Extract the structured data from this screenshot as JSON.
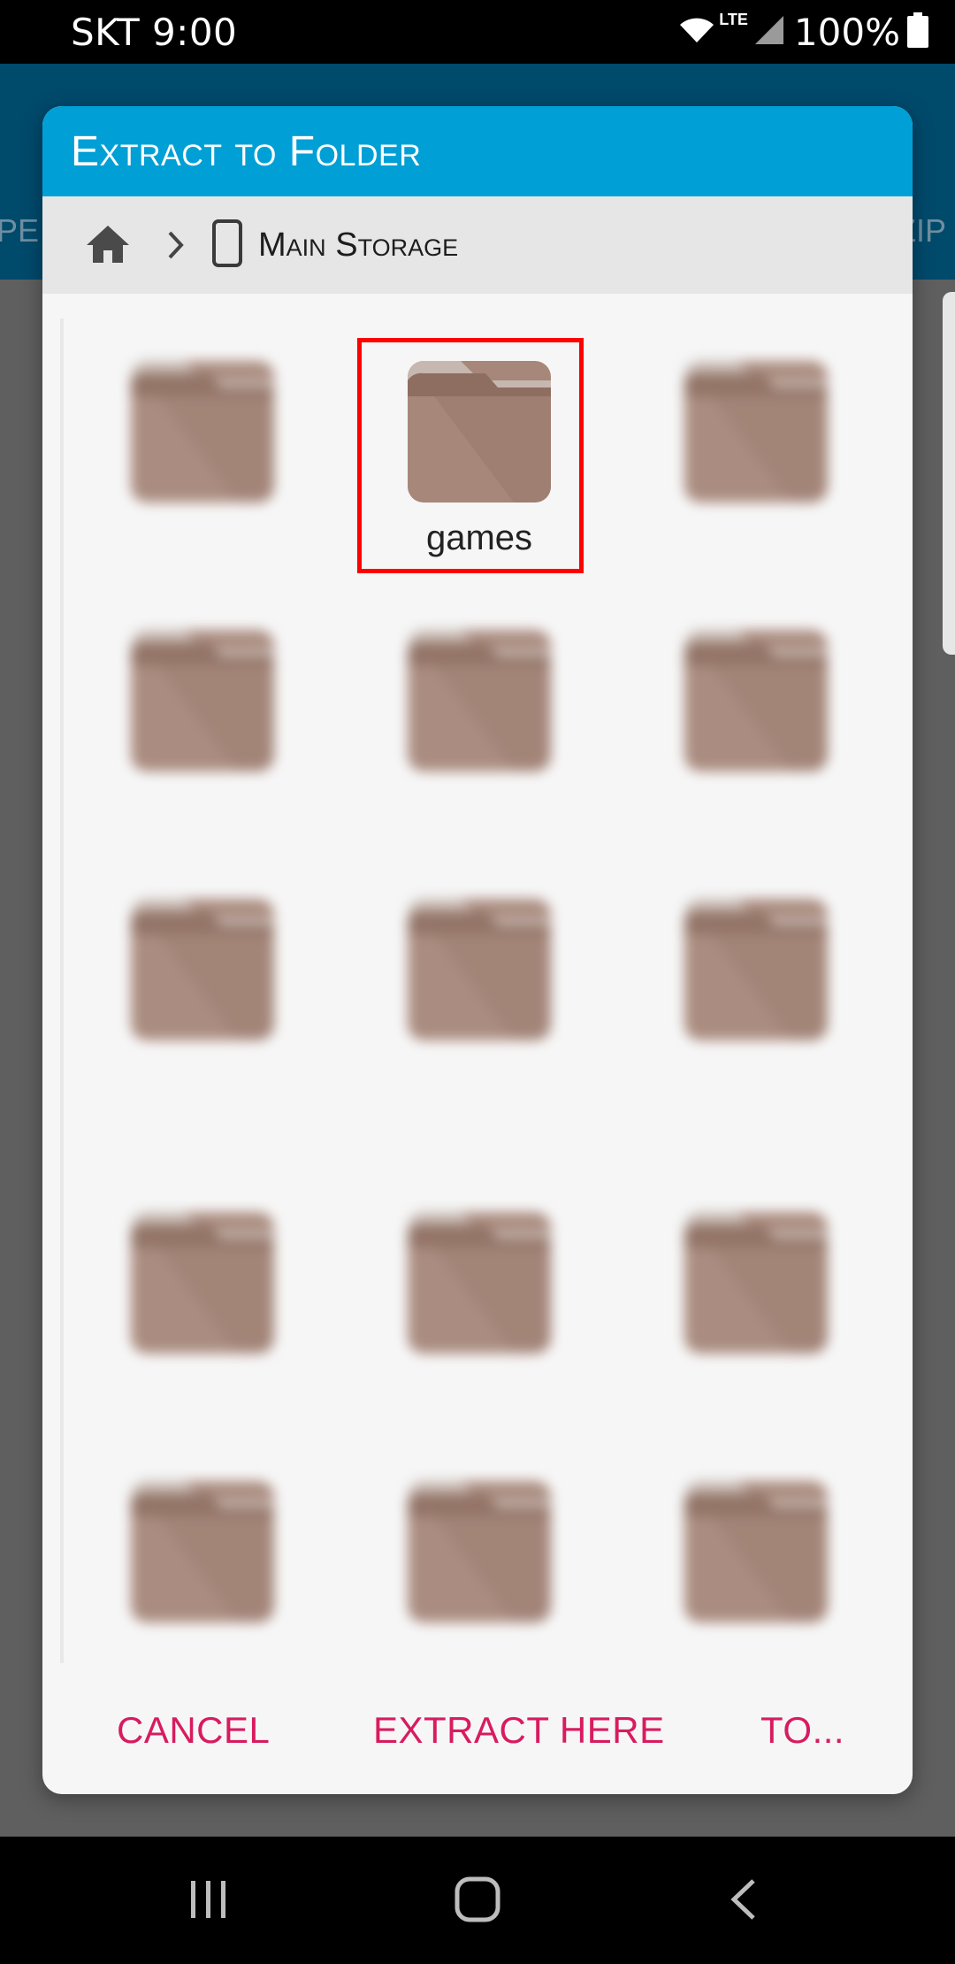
{
  "status_bar": {
    "carrier_time": "SKT 9:00",
    "network": "LTE",
    "battery": "100%"
  },
  "background_app": {
    "left_edge_text": "PE",
    "right_edge_text": "ZIP"
  },
  "dialog": {
    "title": "Extract to Folder",
    "breadcrumb": {
      "location": "Main Storage"
    },
    "folders": [
      {
        "name": "",
        "blurred": true
      },
      {
        "name": "games",
        "blurred": false
      },
      {
        "name": "",
        "blurred": true
      },
      {
        "name": "",
        "blurred": true
      },
      {
        "name": "",
        "blurred": true
      },
      {
        "name": "",
        "blurred": true
      },
      {
        "name": "",
        "blurred": true
      },
      {
        "name": "",
        "blurred": true
      },
      {
        "name": "",
        "blurred": true
      },
      {
        "name": "",
        "blurred": true
      },
      {
        "name": "",
        "blurred": true
      },
      {
        "name": "",
        "blurred": true
      },
      {
        "name": "",
        "blurred": true
      },
      {
        "name": "",
        "blurred": true
      },
      {
        "name": "",
        "blurred": true
      }
    ],
    "actions": {
      "cancel": "CANCEL",
      "extract_here": "EXTRACT HERE",
      "to": "TO..."
    }
  },
  "colors": {
    "title_bar": "#00a0d6",
    "action_text": "#d81b60",
    "folder_body": "#a8887a",
    "highlight": "#ff0000"
  }
}
